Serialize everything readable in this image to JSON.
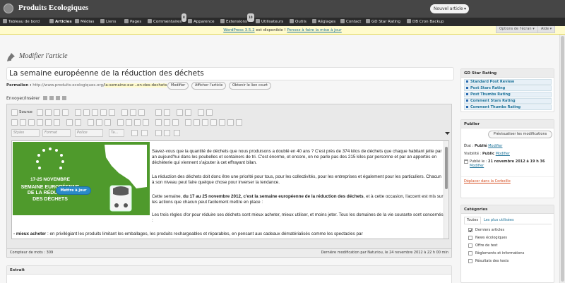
{
  "header": {
    "site_title": "Produits Ecologiques",
    "new_button": "Nouvel article",
    "new_button_arrow": "▾"
  },
  "menu": [
    {
      "label": "Tableau de bord"
    },
    {
      "label": "Articles"
    },
    {
      "label": "Médias"
    },
    {
      "label": "Liens"
    },
    {
      "label": "Pages"
    },
    {
      "label": "Commentaires",
      "badge": "8"
    },
    {
      "label": "Apparence"
    },
    {
      "label": "Extensions",
      "badge": "10"
    },
    {
      "label": "Utilisateurs"
    },
    {
      "label": "Outils"
    },
    {
      "label": "Réglages"
    },
    {
      "label": "Contact"
    },
    {
      "label": "GD Star Rating"
    },
    {
      "label": "DB Cron Backup"
    }
  ],
  "notice": {
    "version_link": "WordPress 3.5.2",
    "text": "est disponible !",
    "update_link": "Pensez à faire la mise à jour"
  },
  "screen_options": "Options de l'écran ▾",
  "help": "Aide ▾",
  "page_title": "Modifier l'article",
  "post": {
    "title": "La semaine européenne de la réduction des déchets",
    "permalink_label": "Permalien :",
    "permalink_base": "http://www.produits-ecologiques.org/",
    "permalink_slug": "la-semaine-eur...on-des-dechets",
    "btn_modify": "Modifier",
    "btn_view": "Afficher l'article",
    "btn_short": "Obtenir le lien court"
  },
  "upload_label": "Envoyer/Insérer",
  "toolbar": {
    "source": "Source",
    "style": "Styles",
    "format": "Format",
    "font": "Police",
    "size": "Ta..."
  },
  "banner": {
    "line1": "17-25 NOVEMBRE",
    "line2": "SEMAINE EUROPÉENNE",
    "line3": "DE LA RÉDUCTION",
    "line4": "DES DÉCHETS"
  },
  "content": {
    "p1": "Savez-vous que la quantité de déchets que nous produisons a doublé en 40 ans ? C'est près de 374 kilos de déchets que chaque habitant jette par an aujourd'hui dans les poubelles et containers de tri. C'est énorme, et encore, on ne parle pas des 215 kilos par personne et par an apportés en déchèterie qui viennent s'ajouter à cet effrayant bilan.",
    "p2": "La réduction des déchets doit donc être une priorité pour tous, pour les collectivités, pour les entreprises et également pour les particuliers. Chacun à son niveau peut faire quelque chose pour inverser la tendance.",
    "p3a": "Cette semaine, ",
    "p3b": "du 17 au 25 novembre 2012, c'est la semaine européenne de la réduction des déchets",
    "p3c": ", et à cette occasion, l'accent est mis sur les actions que chacun peut facilement mettre en place :",
    "p4": "Les trois règles d'or pour réduire ses déchets sont mieux acheter, mieux utiliser, et moins jeter. Tous les domaines de la vie courante sont concernés :",
    "p5a": "- mieux acheter",
    "p5b": " : en privilégiant les produits limitant les emballages, les produits rechargeables et réparables, en pensant aux cadeaux dématérialisés comme les spectacles par"
  },
  "status": {
    "word_count": "Compteur de mots : 309",
    "last_edit": "Dernière modification par Naturiou, le 24 novembre 2012 à 22 h 00 min"
  },
  "excerpt_title": "Extrait",
  "gdsr": {
    "title": "GD Star Rating",
    "items": [
      "Standard Post Review",
      "Post Stars Rating",
      "Post Thumbs Rating",
      "Comment Stars Rating",
      "Comment Thumbs Rating"
    ]
  },
  "publish": {
    "title": "Publier",
    "preview": "Prévisualiser les modifications",
    "state_label": "État : ",
    "state_value": "Publié",
    "visibility_label": "Visibilité : ",
    "visibility_value": "Public",
    "published_label": "Publié le : ",
    "published_value": "21 novembre 2012 à 19 h 36",
    "modify": "Modifier",
    "trash": "Déplacer dans la Corbeille",
    "update": "Mettre à jour"
  },
  "categories": {
    "title": "Catégories",
    "tab_all": "Toutes",
    "tab_used": "Les plus utilisées",
    "items": [
      {
        "label": "Derniers articles",
        "checked": true
      },
      {
        "label": "News écologiques",
        "checked": false
      },
      {
        "label": "Offre de test",
        "checked": false
      },
      {
        "label": "Règlements et informations",
        "checked": false
      },
      {
        "label": "Résultats des tests",
        "checked": false
      }
    ]
  },
  "colors": {
    "header": "#464646",
    "menubar": "#2b2b2b",
    "link": "#21759b",
    "banner_green": "#4f9a2c",
    "publish_button": "#2a8ac8",
    "trash": "#d54e21"
  }
}
